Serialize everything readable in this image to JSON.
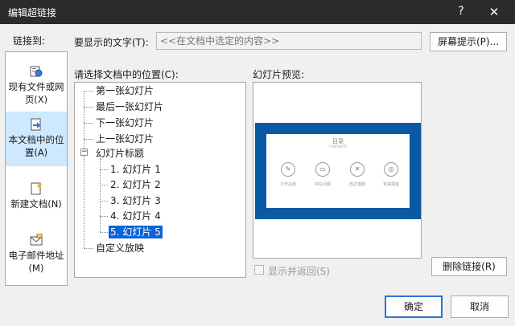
{
  "window": {
    "title": "编辑超链接",
    "help": "?",
    "close": "✕"
  },
  "link_to": {
    "label": "链接到:",
    "items": [
      {
        "label": "现有文件或网页(X)",
        "icon": "existing-file-icon",
        "active": false
      },
      {
        "label": "本文档中的位置(A)",
        "icon": "place-in-document-icon",
        "active": true
      },
      {
        "label": "新建文档(N)",
        "icon": "new-document-icon",
        "active": false
      },
      {
        "label": "电子邮件地址(M)",
        "icon": "email-address-icon",
        "active": false
      }
    ]
  },
  "display_text": {
    "label": "要显示的文字(T):",
    "placeholder": "<<在文档中选定的内容>>"
  },
  "screentip_button": "屏幕提示(P)...",
  "select_place_label": "请选择文档中的位置(C):",
  "tree": {
    "nodes": [
      {
        "label": "第一张幻灯片"
      },
      {
        "label": "最后一张幻灯片"
      },
      {
        "label": "下一张幻灯片"
      },
      {
        "label": "上一张幻灯片"
      },
      {
        "label": "幻灯片标题",
        "expander": "−"
      },
      {
        "label": "1. 幻灯片 1"
      },
      {
        "label": "2. 幻灯片 2"
      },
      {
        "label": "3. 幻灯片 3"
      },
      {
        "label": "4. 幻灯片 4"
      },
      {
        "label": "5. 幻灯片 5",
        "selected": true
      },
      {
        "label": "自定义放映"
      }
    ]
  },
  "preview": {
    "label": "幻灯片预览:",
    "slide_title": "目录",
    "slide_subtitle": "CONTENTS",
    "slide_items": [
      {
        "label": "工作总结",
        "icon": "edit-icon"
      },
      {
        "label": "存在问题",
        "icon": "chat-icon"
      },
      {
        "label": "改正措施",
        "icon": "tools-icon"
      },
      {
        "label": "未来展望",
        "icon": "target-icon"
      }
    ]
  },
  "show_and_return": {
    "label": "显示并返回(S)",
    "checked": false,
    "enabled": false
  },
  "remove_link_button": "删除链接(R)",
  "ok_button": "确定",
  "cancel_button": "取消"
}
